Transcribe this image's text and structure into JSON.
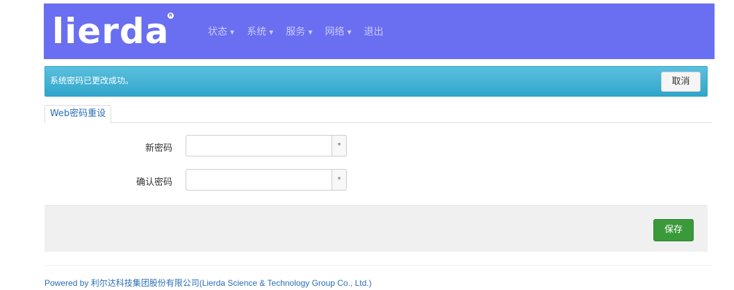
{
  "header": {
    "logo_text": "lierda",
    "logo_mark": "R",
    "menu": [
      {
        "label": "状态",
        "has_caret": true
      },
      {
        "label": "系统",
        "has_caret": true
      },
      {
        "label": "服务",
        "has_caret": true
      },
      {
        "label": "网络",
        "has_caret": true
      },
      {
        "label": "退出",
        "has_caret": false
      }
    ],
    "colors": {
      "navbar": "#6a6ef0",
      "menu_text": "#c9cbfb"
    }
  },
  "alert": {
    "message": "系统密码已更改成功。",
    "cancel_label": "取消",
    "color": "#5bc0de"
  },
  "tabs": [
    {
      "label": "Web密码重设",
      "active": true
    }
  ],
  "form": {
    "fields": [
      {
        "label": "新密码",
        "value": "",
        "addon": "*"
      },
      {
        "label": "确认密码",
        "value": "",
        "addon": "*"
      }
    ]
  },
  "actions": {
    "save_label": "保存",
    "save_color": "#3a9a3a"
  },
  "footer": {
    "powered_by": "Powered by 利尔达科技集团股份有限公司(Lierda Science & Technology Group Co., Ltd.)"
  }
}
